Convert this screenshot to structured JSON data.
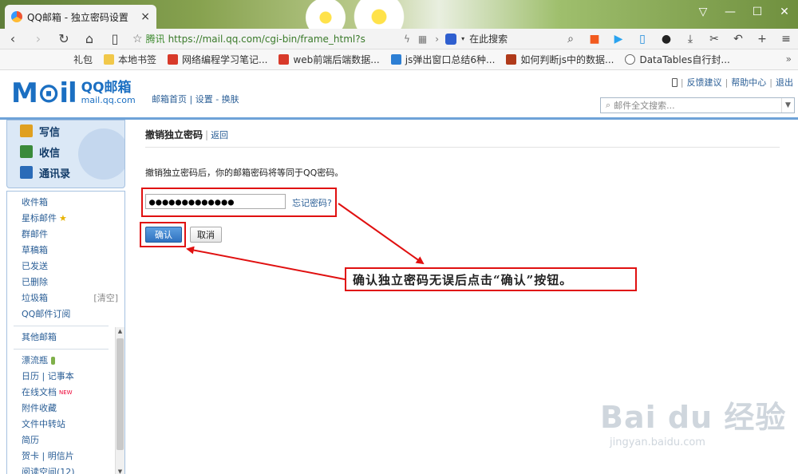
{
  "browser": {
    "tab_title": "QQ邮箱 - 独立密码设置",
    "tab_close": "×",
    "window_controls": [
      "▽",
      "—",
      "☐",
      "✕"
    ],
    "site_name": "腾讯",
    "url": "https://mail.qq.com/cgi-bin/frame_html?s",
    "search_placeholder": "在此搜索",
    "bookmarks": [
      {
        "label": "礼包",
        "color": ""
      },
      {
        "label": "本地书签",
        "color": "#f1c84a"
      },
      {
        "label": "网络编程学习笔记...",
        "color": "#d83a2a"
      },
      {
        "label": "web前端后端数据...",
        "color": "#d83a2a"
      },
      {
        "label": "js弹出窗口总结6种...",
        "color": "#2d7fd4"
      },
      {
        "label": "如何判断js中的数据...",
        "color": "#b03a1a"
      },
      {
        "label": "DataTables自行封...",
        "color": "#666666"
      }
    ]
  },
  "mail_header": {
    "logo_mark": "M⊙il",
    "brand_cn": "QQ邮箱",
    "brand_domain": "mail.qq.com",
    "nav_links": "邮箱首页 | 设置 - 换肤",
    "top_links": [
      "反馈建议",
      "帮助中心",
      "退出"
    ],
    "search_placeholder": "邮件全文搜索..."
  },
  "sidebar": {
    "actions": [
      {
        "label": "写信",
        "color": "#e0a020"
      },
      {
        "label": "收信",
        "color": "#3a8a3a"
      },
      {
        "label": "通讯录",
        "color": "#2a6bb8"
      }
    ],
    "folders": [
      {
        "label": "收件箱"
      },
      {
        "label": "星标邮件"
      },
      {
        "label": "群邮件"
      },
      {
        "label": "草稿箱"
      },
      {
        "label": "已发送"
      },
      {
        "label": "已删除"
      },
      {
        "label": "垃圾箱",
        "extra": "[清空]"
      },
      {
        "label": "QQ邮件订阅"
      }
    ],
    "other_mailbox": "其他邮箱",
    "apps": [
      {
        "label": "漂流瓶"
      },
      {
        "label": "日历  |  记事本"
      },
      {
        "label": "在线文档",
        "badge": "NEW"
      },
      {
        "label": "附件收藏"
      },
      {
        "label": "文件中转站"
      },
      {
        "label": "简历"
      },
      {
        "label": "贺卡  |  明信片"
      },
      {
        "label": "阅读空间(12)"
      }
    ]
  },
  "main": {
    "title": "撤销独立密码",
    "back_link": "返回",
    "description": "撤销独立密码后，你的邮箱密码将等同于QQ密码。",
    "password_value": "●●●●●●●●●●●●●",
    "forgot_link": "忘记密码?",
    "confirm_button": "确认",
    "cancel_button": "取消"
  },
  "annotation": {
    "callout_text": "确认独立密码无误后点击“确认”按钮。",
    "color": "#e01010"
  },
  "watermark": {
    "text": "Bai du 经验",
    "url": "jingyan.baidu.com"
  }
}
